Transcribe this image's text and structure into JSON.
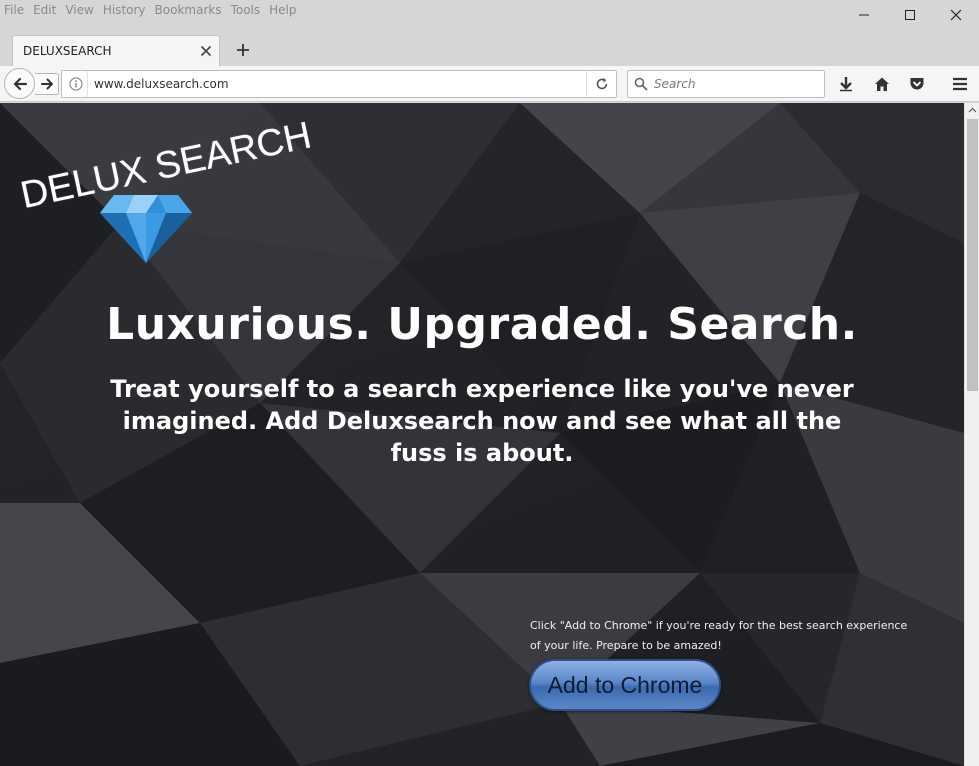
{
  "menu": [
    "File",
    "Edit",
    "View",
    "History",
    "Bookmarks",
    "Tools",
    "Help"
  ],
  "tab": {
    "title": "DELUXSEARCH"
  },
  "navbar": {
    "url": "www.deluxsearch.com",
    "search_placeholder": "Search"
  },
  "page": {
    "logo_text": "DELUX SEARCH",
    "headline": "Luxurious. Upgraded. Search.",
    "subtext": "Treat yourself to a search experience like you've never imagined. Add Deluxsearch now and see what all the fuss is about.",
    "cta_note": "Click \"Add to Chrome\" if you're ready for the best search experience of your life. Prepare to be amazed!",
    "cta_button": "Add to Chrome"
  },
  "colors": {
    "page_bg": "#26272b",
    "button_blue": "#5a86c9",
    "diamond_blue": "#2f8fd8"
  },
  "icons": [
    "back-arrow-icon",
    "forward-arrow-icon",
    "info-icon",
    "reload-icon",
    "search-icon",
    "download-icon",
    "home-icon",
    "pocket-icon",
    "hamburger-menu-icon",
    "close-icon",
    "plus-icon",
    "minimize-icon",
    "maximize-icon"
  ]
}
